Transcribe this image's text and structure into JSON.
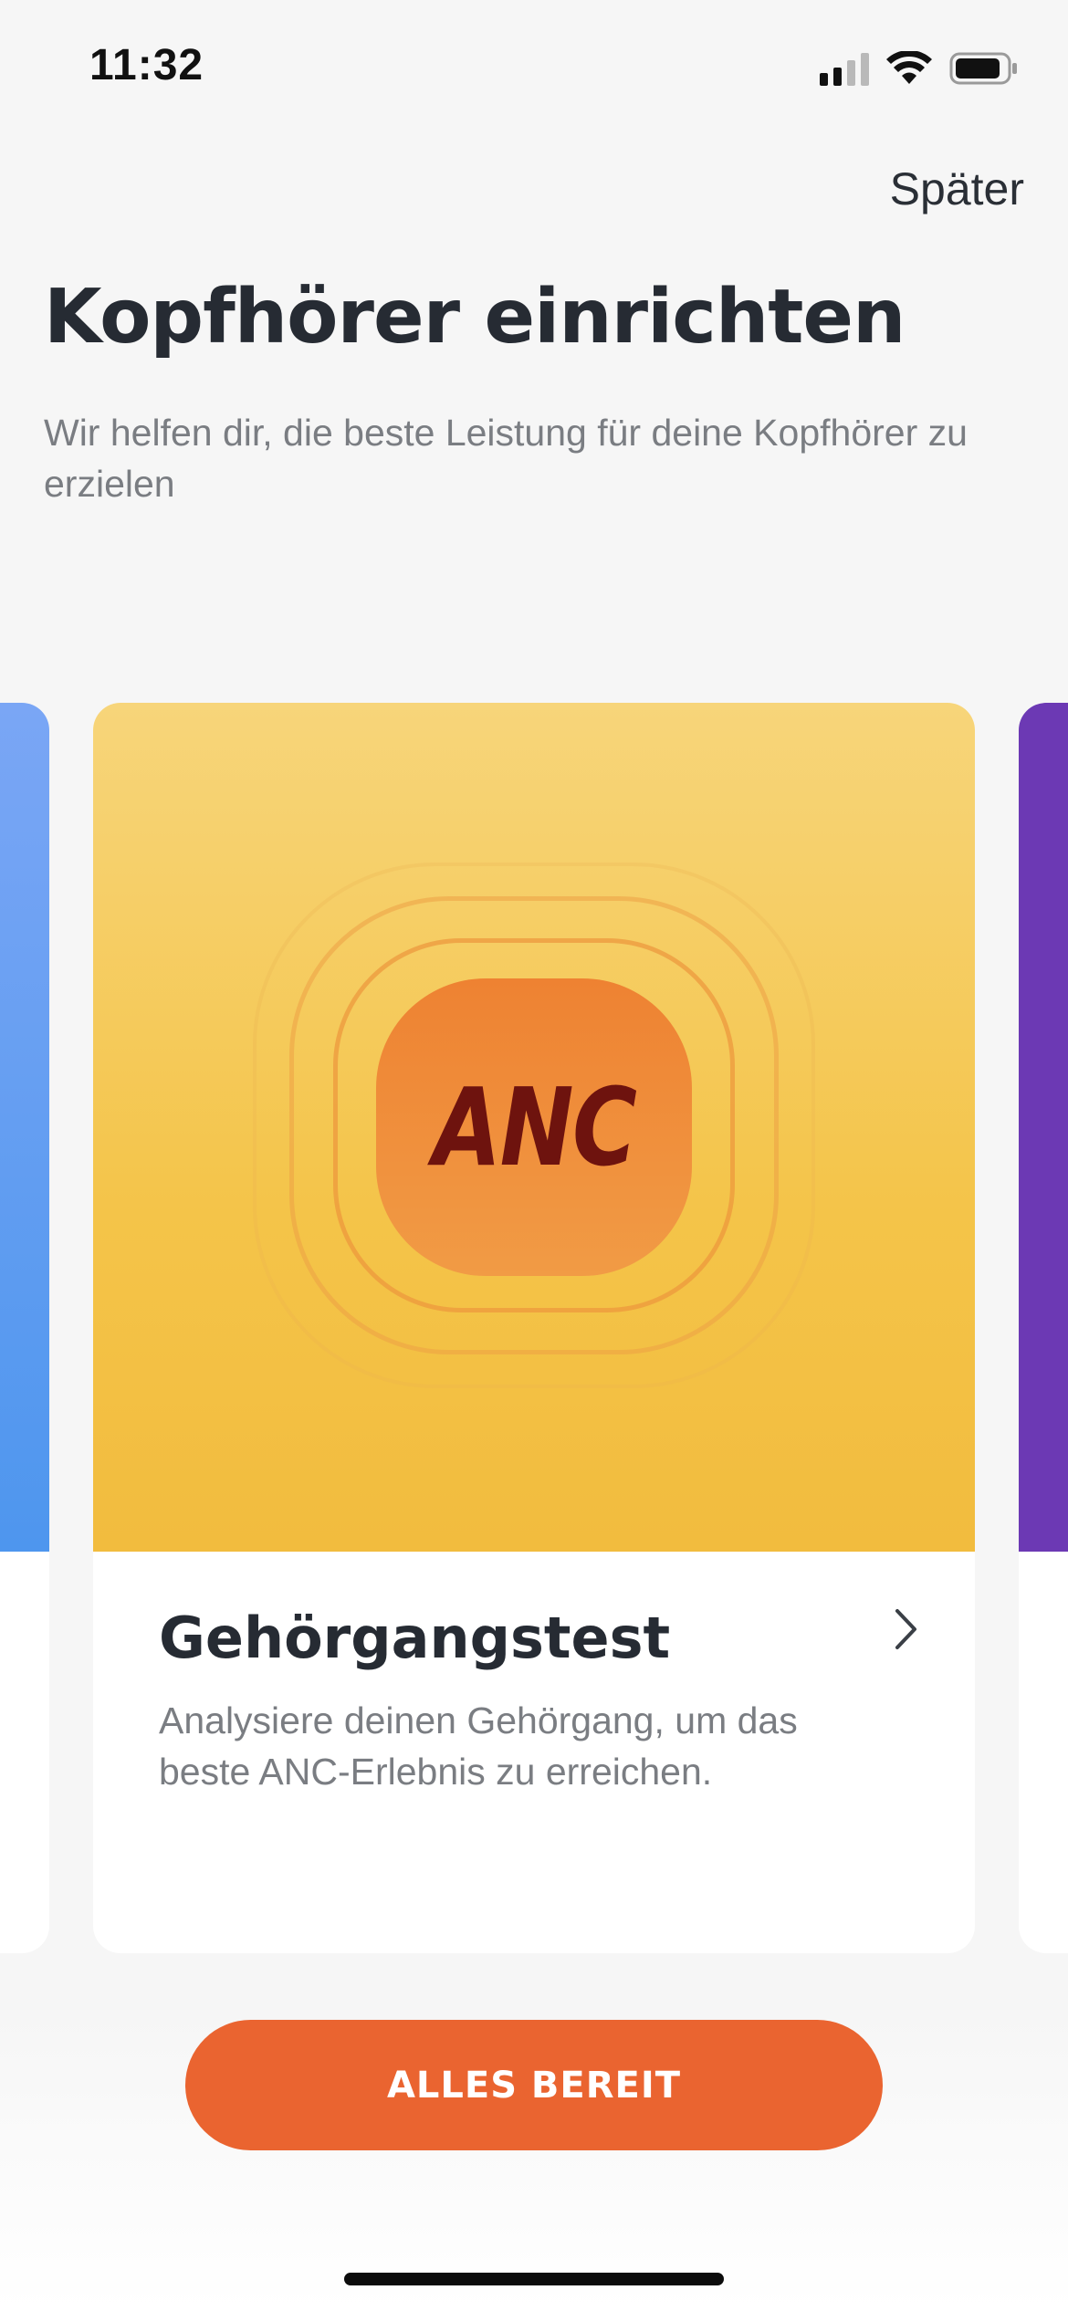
{
  "status_bar": {
    "time": "11:32",
    "icons": [
      "signal-icon",
      "wifi-icon",
      "battery-icon"
    ]
  },
  "header": {
    "later_label": "Später",
    "title": "Kopfhörer einrichten",
    "subtitle": "Wir helfen dir, die beste Leistung für deine Kopfhörer zu erzielen"
  },
  "cards": [
    {
      "badge_text": "ANC",
      "title": "Gehörgangstest",
      "description": "Analysiere deinen Gehörgang, um das beste ANC-Erlebnis zu erreichen.",
      "chevron": "chevron-right-icon"
    }
  ],
  "colors": {
    "accent": "#ea6430",
    "card_art_top": "#f7d57a",
    "card_art_bottom": "#f2bc3e",
    "badge": "#ee8232",
    "badge_text": "#6e130e",
    "left_card": "#4e96ee",
    "right_card": "#6c39b4"
  },
  "footer": {
    "cta_label": "ALLES BEREIT"
  }
}
